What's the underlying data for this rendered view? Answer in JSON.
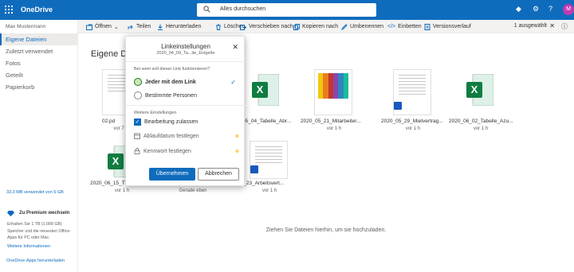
{
  "app": {
    "brand": "OneDrive",
    "avatar_initial": "M"
  },
  "search": {
    "placeholder": "Alles durchsuchen"
  },
  "sidebar": {
    "user": "Max Mustermann",
    "items": [
      {
        "label": "Eigene Dateien",
        "active": true
      },
      {
        "label": "Zuletzt verwendet"
      },
      {
        "label": "Fotos"
      },
      {
        "label": "Geteilt"
      },
      {
        "label": "Papierkorb"
      }
    ],
    "quota": "33,3 MB verwendet von 5 GB",
    "premium_title": "Zu Premium wechseln",
    "premium_desc": "Erhalten Sie 1 TB (1.000 GB) Speicher und die neuesten Office-Apps für PC oder Mac.",
    "premium_link": "Weitere Informationen",
    "apps_link": "OneDrive-Apps herunterladen"
  },
  "toolbar": {
    "open": "Öffnen",
    "share": "Teilen",
    "download": "Herunterladen",
    "delete": "Löschen",
    "move": "Verschieben nach",
    "copy": "Kopieren nach",
    "rename": "Umbenennen",
    "embed": "Einbetten",
    "history": "Versionsverlauf",
    "selected": "1 ausgewählt"
  },
  "main": {
    "title": "Eigene Dat",
    "dropzone": "Ziehen Sie Dateien hierhin, um sie hochzuladen."
  },
  "files": [
    {
      "name": "02.pd",
      "sub": "vor 7"
    },
    {
      "name": "05_04_Tabelle_Abr...",
      "sub": ""
    },
    {
      "name": "2020_05_21_Mitarbeiter...",
      "sub": "vor 1 h"
    },
    {
      "name": "2020_05_29_Mietvertrag...",
      "sub": "vor 1 h"
    },
    {
      "name": "2020_06_02_Tabelle_Azu...",
      "sub": "vor 1 h"
    },
    {
      "name": "2020_06_15_T",
      "sub": "vor 1 h"
    },
    {
      "name": "",
      "sub": "Gerade eben"
    },
    {
      "name": "06_23_Arbeitsvert...",
      "sub": "vor 1 h"
    }
  ],
  "dialog": {
    "title": "Linkeinstellungen",
    "subtitle": "2020_04_09_Ta...ite_Entgelte",
    "question": "Bei wem soll dieser Link funktionieren?",
    "option_anyone": "Jeder mit dem Link",
    "option_specific": "Bestimmte Personen",
    "more_settings": "Weitere Einstellungen",
    "allow_edit": "Bearbeitung zulassen",
    "expiry": "Ablaufdatum festlegen",
    "password": "Kennwort festlegen",
    "apply": "Übernehmen",
    "cancel": "Abbrechen"
  },
  "colors": {
    "accent": "#0f6cbd",
    "excel": "#107c41",
    "word": "#185abd",
    "premium": "#ffb900"
  }
}
